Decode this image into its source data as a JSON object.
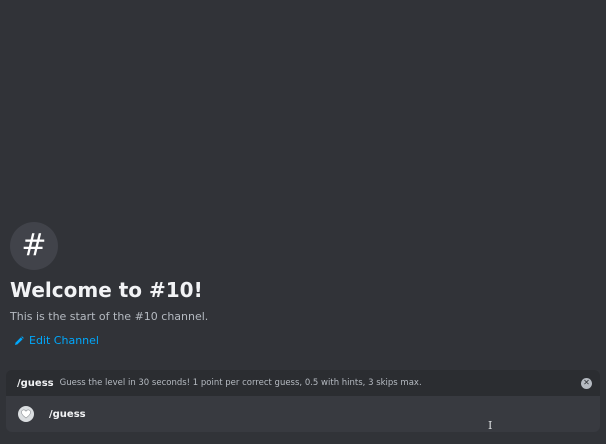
{
  "welcome": {
    "hash_glyph": "#",
    "title": "Welcome to #10!",
    "subtitle": "This is the start of the #10 channel.",
    "edit_channel_label": "Edit Channel"
  },
  "command_popup": {
    "command": "/guess",
    "description": "Guess the level in 30 seconds! 1 point per correct guess, 0.5 with hints, 3 skips max.",
    "close_glyph": "✕"
  },
  "input": {
    "command_text": "/guess",
    "app_icon": "heart-icon"
  },
  "cursor_glyph": "I",
  "colors": {
    "background": "#313338",
    "popup_bg": "#2b2d31",
    "input_bg": "#383a40",
    "link": "#00a8fc"
  }
}
